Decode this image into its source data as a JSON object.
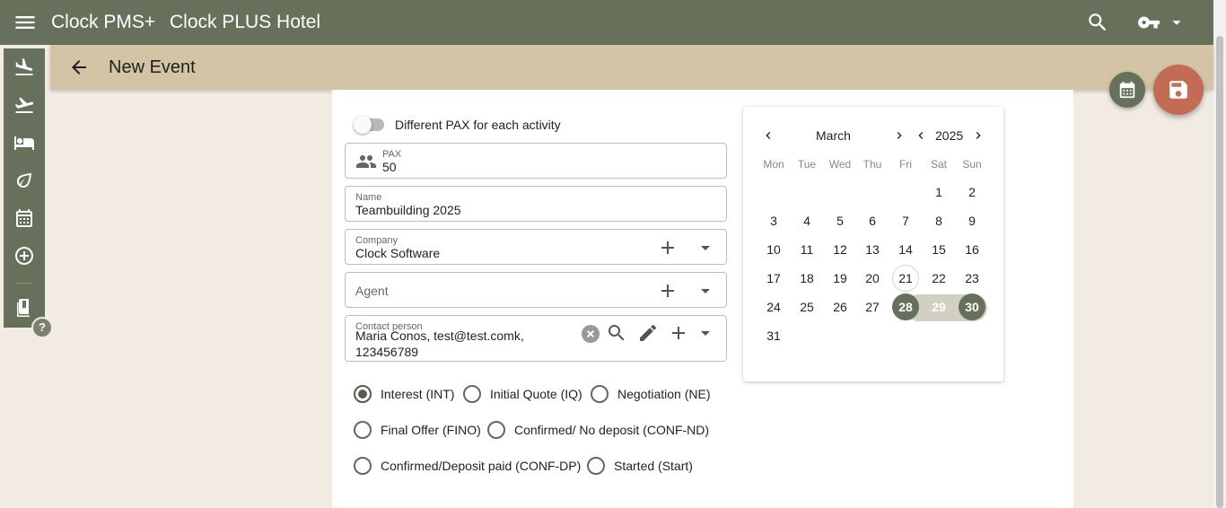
{
  "app": {
    "title": "Clock PMS+",
    "hotel": "Clock PLUS Hotel"
  },
  "icons": {
    "menu": "menu-icon",
    "search": "search-icon",
    "key": "key-icon",
    "caret": "caret-down-icon",
    "arrivals": "flight-land-icon",
    "departures": "flight-takeoff-icon",
    "rooms": "bed-icon",
    "eco": "leaf-icon",
    "events": "calendar-icon",
    "add": "add-circle-icon",
    "bookmarks": "book-icon",
    "help": "help-icon",
    "back": "arrow-back-icon",
    "save": "save-icon"
  },
  "colors": {
    "primary": "#66705a",
    "subheader": "#d2c4a5",
    "accent": "#c46b55",
    "background": "#f2ebe4"
  },
  "help_label": "?",
  "page": {
    "title": "New Event"
  },
  "form": {
    "toggle_label": "Different PAX for each activity",
    "toggle_on": false,
    "pax": {
      "label": "PAX",
      "value": "50"
    },
    "name": {
      "label": "Name",
      "value": "Teambuilding 2025"
    },
    "company": {
      "label": "Company",
      "value": "Clock Software"
    },
    "agent": {
      "placeholder": "Agent"
    },
    "contact": {
      "label": "Contact person",
      "value_line1": "Maria Conos, test@test.comk,",
      "value_line2": "123456789"
    }
  },
  "statuses": [
    {
      "label": "Interest (INT)",
      "checked": true
    },
    {
      "label": "Initial Quote (IQ)",
      "checked": false
    },
    {
      "label": "Negotiation (NE)",
      "checked": false
    },
    {
      "label": "Final Offer (FINO)",
      "checked": false
    },
    {
      "label": "Confirmed/ No deposit (CONF-ND)",
      "checked": false
    },
    {
      "label": "Confirmed/Deposit paid (CONF-DP)",
      "checked": false
    },
    {
      "label": "Started (Start)",
      "checked": false
    }
  ],
  "calendar": {
    "month": "March",
    "year": "2025",
    "weekdays": [
      "Mon",
      "Tue",
      "Wed",
      "Thu",
      "Fri",
      "Sat",
      "Sun"
    ],
    "first_weekday_index": 5,
    "days_in_month": 31,
    "today": 21,
    "range_start": 28,
    "range_end": 30
  }
}
